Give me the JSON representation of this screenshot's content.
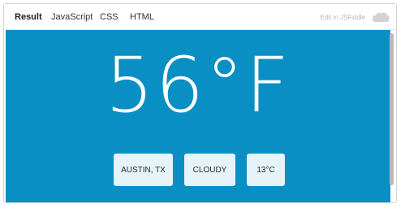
{
  "tabs": [
    {
      "label": "Result",
      "active": true
    },
    {
      "label": "JavaScript",
      "active": false
    },
    {
      "label": "CSS",
      "active": false
    },
    {
      "label": "HTML",
      "active": false
    }
  ],
  "edit_link": "Edit in JSFiddle",
  "weather": {
    "temperature": "56°F",
    "location": "AUSTIN, TX",
    "condition": "CLOUDY",
    "celsius": "13°C"
  },
  "colors": {
    "background": "#0a8fc4",
    "card": "#e6f3f8"
  },
  "icons": {
    "cloud": "cloud-icon"
  }
}
